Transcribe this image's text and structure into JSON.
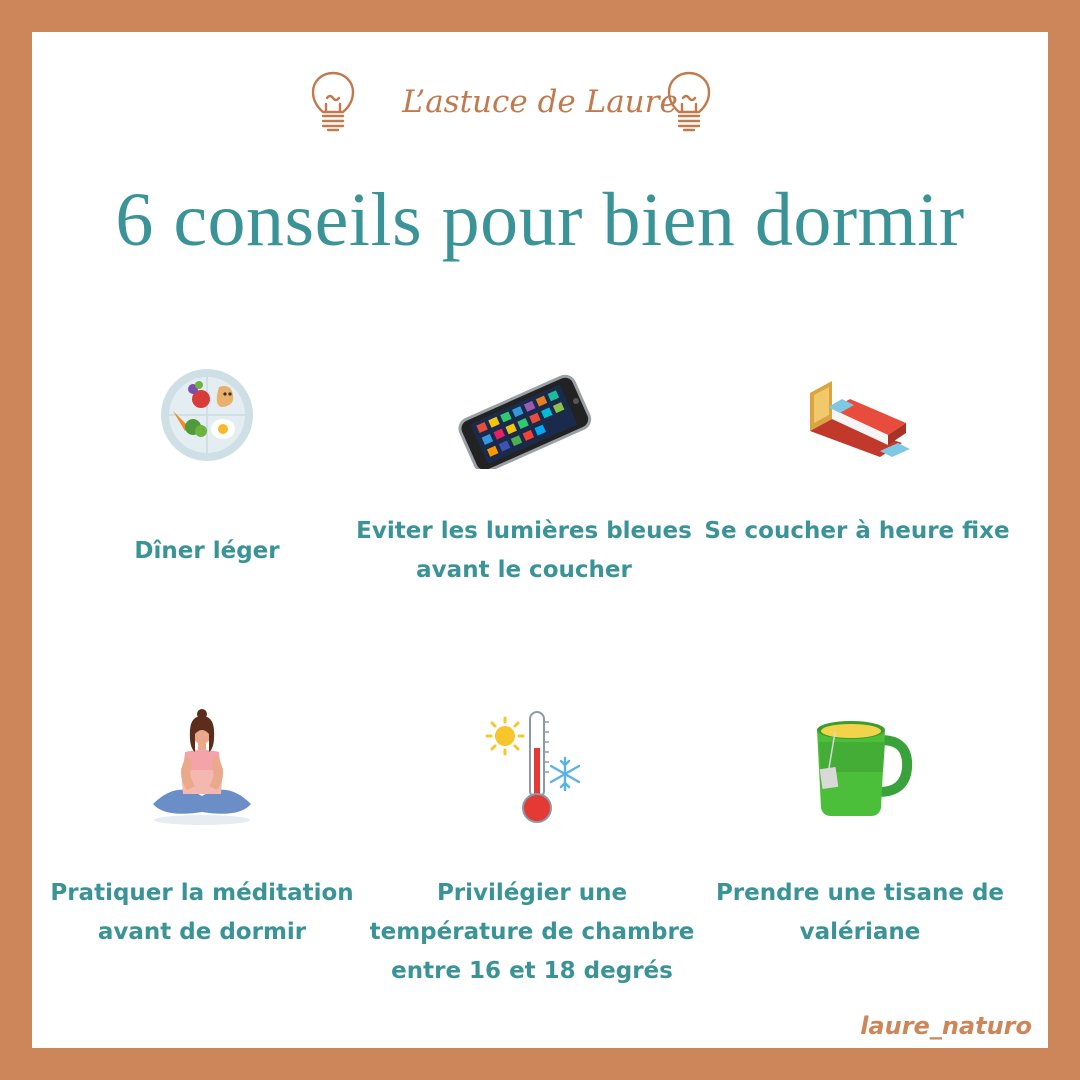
{
  "header": {
    "tagline": "L’astuce de Laure"
  },
  "title": "6 conseils pour bien dormir",
  "tips": [
    {
      "icon": "healthy-plate-icon",
      "label": "Dîner léger"
    },
    {
      "icon": "smartphone-icon",
      "label": "Eviter les lumières bleues avant le coucher"
    },
    {
      "icon": "bed-icon",
      "label": "Se coucher à heure fixe"
    },
    {
      "icon": "meditation-woman-icon",
      "label": "Pratiquer la méditation avant de dormir"
    },
    {
      "icon": "thermometer-icon",
      "label": "Privilégier  une température de chambre entre 16 et 18 degrés"
    },
    {
      "icon": "tea-mug-icon",
      "label": "Prendre une tisane de valériane"
    }
  ],
  "footer": {
    "handle": "laure_naturo"
  },
  "colors": {
    "frame": "#cd8659",
    "teal": "#3a9397",
    "tagline": "#c07a4e"
  }
}
